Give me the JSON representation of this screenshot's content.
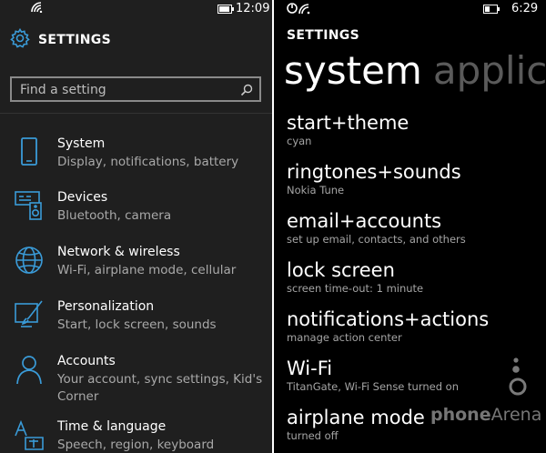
{
  "left": {
    "status": {
      "time": "12:09"
    },
    "header": {
      "title": "SETTINGS",
      "icon": "gear-icon"
    },
    "search": {
      "placeholder": "Find a setting",
      "icon": "search-icon"
    },
    "accent": "#3a9bd8",
    "items": [
      {
        "title": "System",
        "subtitle": "Display, notifications, battery",
        "icon": "phone-icon"
      },
      {
        "title": "Devices",
        "subtitle": "Bluetooth, camera",
        "icon": "devices-icon"
      },
      {
        "title": "Network & wireless",
        "subtitle": "Wi-Fi, airplane mode, cellular",
        "icon": "globe-icon"
      },
      {
        "title": "Personalization",
        "subtitle": "Start, lock screen, sounds",
        "icon": "paint-icon"
      },
      {
        "title": "Accounts",
        "subtitle": "Your account, sync settings, Kid's Corner",
        "icon": "person-icon"
      },
      {
        "title": "Time & language",
        "subtitle": "Speech, region, keyboard",
        "icon": "language-icon"
      }
    ]
  },
  "right": {
    "status": {
      "time": "6:29"
    },
    "header": {
      "title": "SETTINGS"
    },
    "pivot": {
      "active": "system",
      "next": "applica"
    },
    "items": [
      {
        "title": "start+theme",
        "subtitle": "cyan"
      },
      {
        "title": "ringtones+sounds",
        "subtitle": "Nokia Tune"
      },
      {
        "title": "email+accounts",
        "subtitle": "set up email, contacts, and others"
      },
      {
        "title": "lock screen",
        "subtitle": "screen time-out: 1 minute"
      },
      {
        "title": "notifications+actions",
        "subtitle": "manage action center"
      },
      {
        "title": "Wi-Fi",
        "subtitle": "TitanGate, Wi-Fi Sense turned on"
      },
      {
        "title": "airplane mode",
        "subtitle": "turned off"
      }
    ]
  },
  "watermark": {
    "part1": "phone",
    "part2": "Arena"
  }
}
